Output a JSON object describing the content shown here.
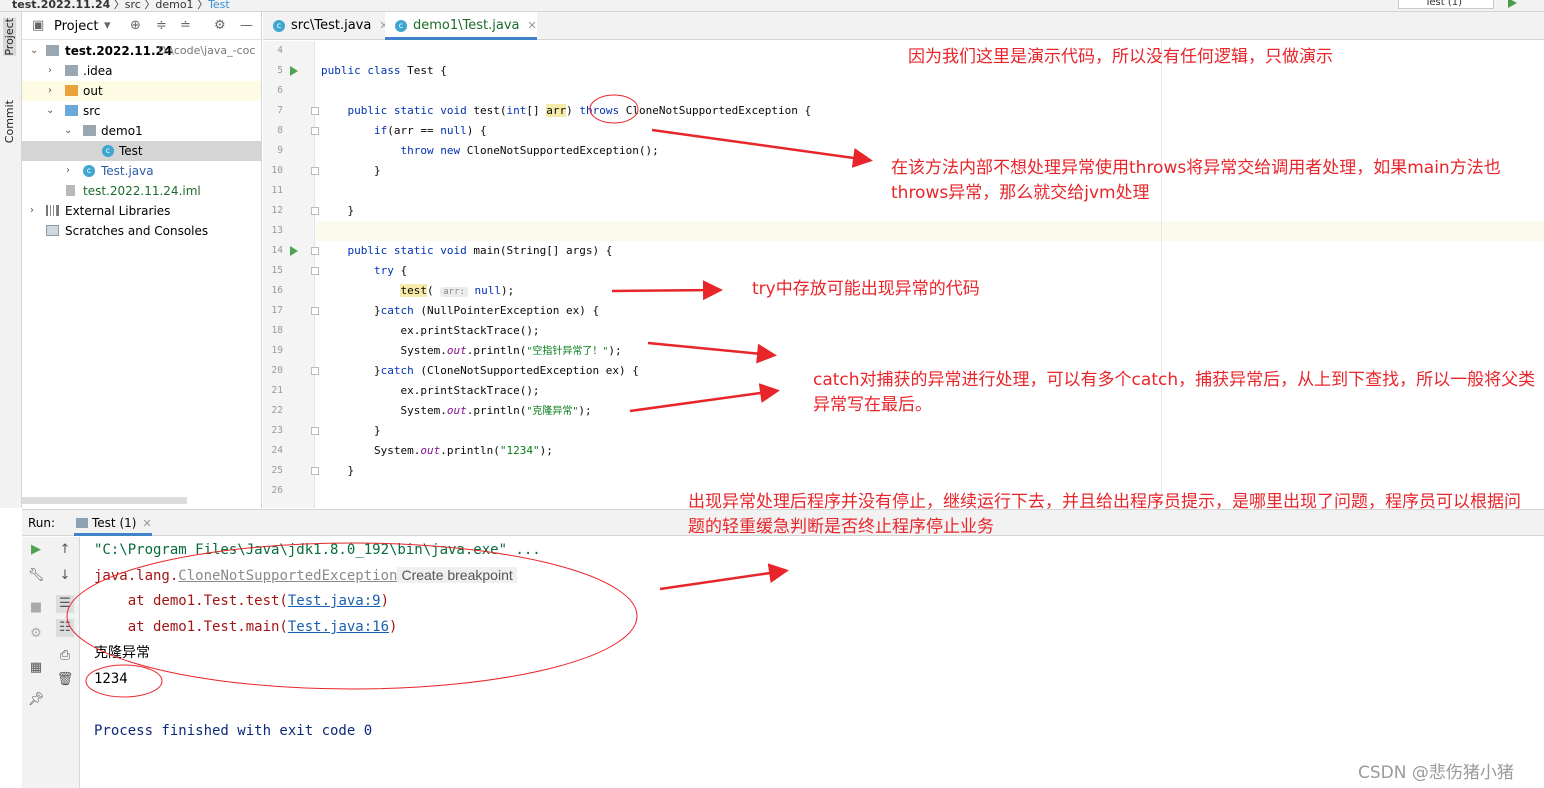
{
  "window": {
    "breadcrumb": [
      "test.2022.11.24",
      "src",
      "demo1",
      "Test"
    ],
    "run_config": "Test (1)"
  },
  "left_strip": {
    "project_tab": "Project",
    "commit_tab": "Commit"
  },
  "project_panel": {
    "title": "Project",
    "tree": [
      {
        "label": "test.2022.11.24",
        "suffix": "D:\\code\\java_-coc"
      },
      {
        "label": ".idea"
      },
      {
        "label": "out"
      },
      {
        "label": "src"
      },
      {
        "label": "demo1"
      },
      {
        "label": "Test"
      },
      {
        "label": "Test.java"
      },
      {
        "label": "test.2022.11.24.iml"
      },
      {
        "label": "External Libraries"
      },
      {
        "label": "Scratches and Consoles"
      }
    ]
  },
  "editor_tabs": [
    {
      "label": "src\\Test.java",
      "icon_text": "c"
    },
    {
      "label": "demo1\\Test.java",
      "icon_text": "c"
    }
  ],
  "code": {
    "line_numbers": [
      "4",
      "5",
      "6",
      "7",
      "8",
      "9",
      "10",
      "11",
      "12",
      "13",
      "14",
      "15",
      "16",
      "17",
      "18",
      "19",
      "20",
      "21",
      "22",
      "23",
      "24",
      "25",
      "26"
    ],
    "l5_kw": "public class",
    "l5_rest": " Test {",
    "l7_kw": "public static void",
    "l7_a": " test(",
    "l7_int": "int",
    "l7_b": "[] ",
    "l7_arr": "arr",
    "l7_c": ") ",
    "l7_throws": "throws",
    "l7_d": " CloneNotSupportedException {",
    "l8_kw": "if",
    "l8_a": "(arr == ",
    "l8_null": "null",
    "l8_b": ") {",
    "l9_throw": "throw",
    "l9_new": "new",
    "l9_rest": " CloneNotSupportedException();",
    "l10": "}",
    "l12": "}",
    "l14_kw": "public static void",
    "l14_rest": " main(String[] args) {",
    "l15_try": "try",
    "l15_rest": " {",
    "l16_a": "test",
    "l16_b": "( ",
    "l16_hint": "arr:",
    "l16_null": "null",
    "l16_c": ");",
    "l17_a": "}",
    "l17_catch": "catch",
    "l17_b": " (NullPointerException ex) {",
    "l18": "ex.printStackTrace();",
    "l19_a": "System.",
    "l19_out": "out",
    "l19_b": ".println(",
    "l19_str": "\"空指针异常了！\"",
    "l19_c": ");",
    "l20_a": "}",
    "l20_catch": "catch",
    "l20_b": " (CloneNotSupportedException ex) {",
    "l21": "ex.printStackTrace();",
    "l22_a": "System.",
    "l22_out": "out",
    "l22_b": ".println(",
    "l22_str": "\"克隆异常\"",
    "l22_c": ");",
    "l23": "}",
    "l24_a": "System.",
    "l24_out": "out",
    "l24_b": ".println(",
    "l24_str": "\"1234\"",
    "l24_c": ");",
    "l25": "}"
  },
  "run_panel": {
    "label": "Run:",
    "tab": "Test (1)",
    "console": {
      "cmd": "\"C:\\Program Files\\Java\\jdk1.8.0_192\\bin\\java.exe\" ...",
      "exc_prefix": "java.lang.",
      "exc_name": "CloneNotSupportedException",
      "breakpoint": "Create breakpoint",
      "at1_prefix": "    at demo1.Test.test(",
      "at1_link": "Test.java:9",
      "at2_prefix": "    at demo1.Test.main(",
      "at2_link": "Test.java:16",
      "at_suffix": ")",
      "out1": "克隆异常",
      "out2": "1234",
      "finished": "Process finished with exit code 0"
    }
  },
  "annotations": {
    "a1": "因为我们这里是演示代码，所以没有任何逻辑，只做演示",
    "a2": "在该方法内部不想处理异常使用throws将异常交给调用者处理，如果main方法也throws异常，那么就交给jvm处理",
    "a3": "try中存放可能出现异常的代码",
    "a4": "catch对捕获的异常进行处理，可以有多个catch，捕获异常后，从上到下查找，所以一般将父类异常写在最后。",
    "a5": "出现异常处理后程序并没有停止，继续运行下去，并且给出程序员提示，是哪里出现了问题，程序员可以根据问题的轻重缓急判断是否终止程序停止业务",
    "color": "#e8252a"
  },
  "watermark": "CSDN @悲伤猪小猪"
}
